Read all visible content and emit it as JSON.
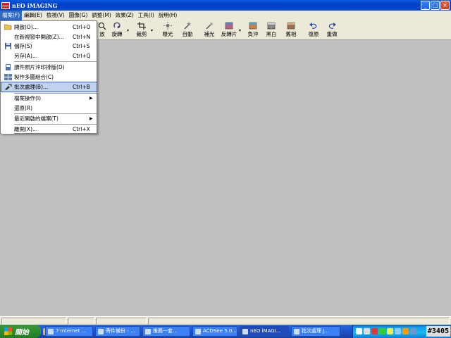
{
  "window": {
    "title": "nEO iMAGING"
  },
  "menubar": [
    {
      "label": "檔案(F)",
      "open": true
    },
    {
      "label": "編輯(E)"
    },
    {
      "label": "檢視(V)"
    },
    {
      "label": "圖像(G)"
    },
    {
      "label": "調整(M)"
    },
    {
      "label": "效果(Z)"
    },
    {
      "label": "工具(I)"
    },
    {
      "label": "說明(H)"
    }
  ],
  "toolbar": [
    {
      "label": "放",
      "icon": "zoom-icon"
    },
    {
      "label": "旋轉",
      "icon": "rotate-icon"
    },
    {
      "label": "裁剪",
      "icon": "crop-icon"
    },
    {
      "label": "曝光",
      "icon": "exposure-icon"
    },
    {
      "label": "自動",
      "icon": "auto-icon"
    },
    {
      "label": "補光",
      "icon": "fill-light-icon"
    },
    {
      "label": "反轉片",
      "icon": "reversal-film-icon"
    },
    {
      "label": "負沖",
      "icon": "cross-process-icon"
    },
    {
      "label": "黑白",
      "icon": "black-white-icon"
    },
    {
      "label": "舊相",
      "icon": "old-photo-icon"
    },
    {
      "label": "復原",
      "icon": "undo-icon"
    },
    {
      "label": "重做",
      "icon": "redo-icon"
    }
  ],
  "file_menu": [
    {
      "label": "開啟(O)...",
      "shortcut": "Ctrl+O",
      "icon": "folder-open-icon"
    },
    {
      "label": "在新視窗中開啟(Z)...",
      "shortcut": "Ctrl+N"
    },
    {
      "label": "儲存(S)",
      "shortcut": "Ctrl+S",
      "icon": "save-icon"
    },
    {
      "label": "另存(A)...",
      "shortcut": "Ctrl+Q"
    },
    {
      "label": "讀件照片沖印排版(D)",
      "icon": "print-layout-icon"
    },
    {
      "label": "製作多圖組合(C)",
      "icon": "collage-icon"
    },
    {
      "label": "批次處理(B)...",
      "shortcut": "Ctrl+B",
      "icon": "batch-icon",
      "highlighted": true
    },
    {
      "label": "檔案操作(I)",
      "submenu": true
    },
    {
      "label": "還原(R)"
    },
    {
      "label": "最近開啟的檔案(T)",
      "submenu": true
    },
    {
      "label": "離開(X)...",
      "shortcut": "Ctrl+X"
    }
  ],
  "taskbar": {
    "start_label": "開始",
    "tasks": [
      {
        "label": "7 Internet ..."
      },
      {
        "label": "寄件備份 - ..."
      },
      {
        "label": "推薦一套..."
      },
      {
        "label": "ACDSee 5.0..."
      },
      {
        "label": "nEO iMAGI...",
        "active": true
      },
      {
        "label": "批次處理 J..."
      }
    ],
    "badge": "#3405"
  },
  "colors": {
    "titlebar": "#0a5ae0",
    "highlight": "#316ac5",
    "workspace": "#c0c0c0",
    "menubar": "#ece9d8"
  }
}
